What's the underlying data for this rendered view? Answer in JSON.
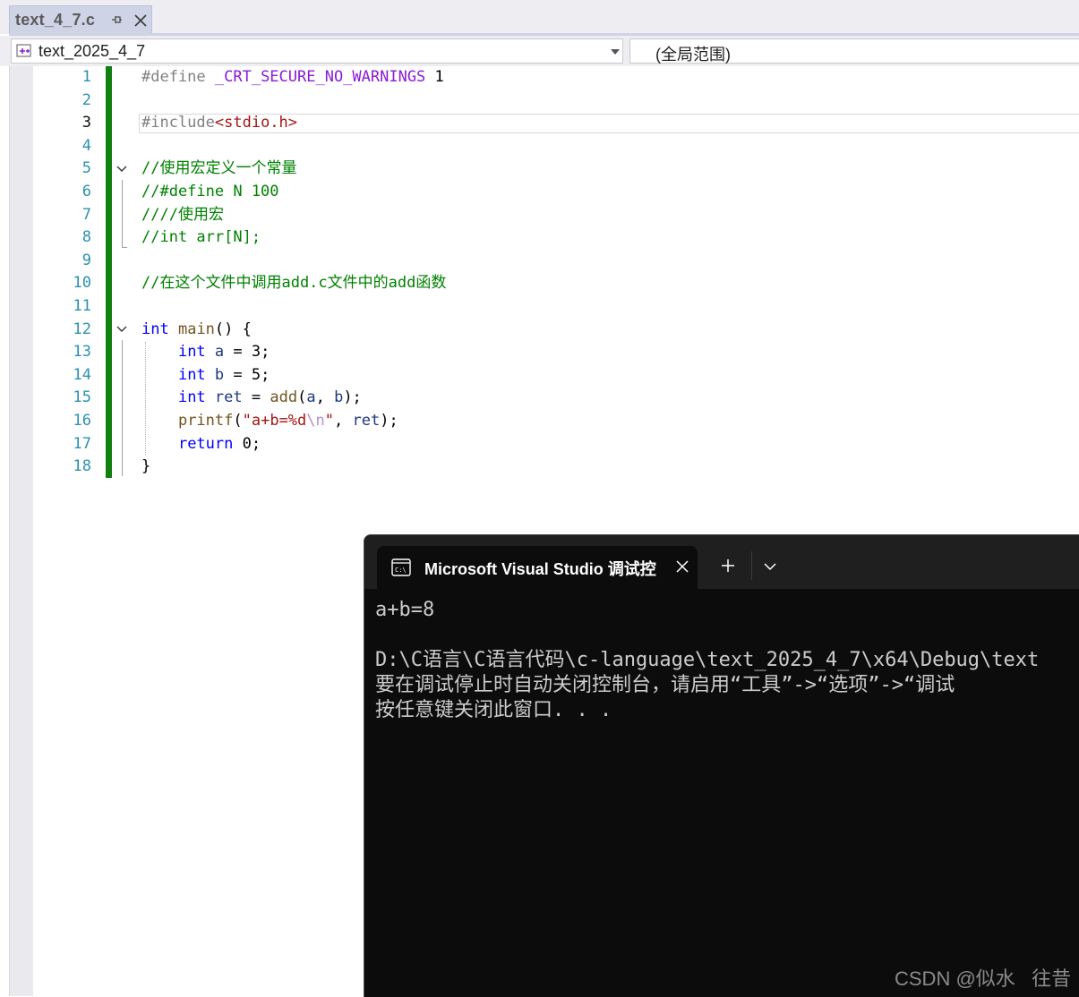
{
  "tab": {
    "title": "text_4_7.c"
  },
  "nav": {
    "project": "text_2025_4_7",
    "scope": "(全局范围)"
  },
  "editor": {
    "line_numbers": [
      "1",
      "2",
      "3",
      "4",
      "5",
      "6",
      "7",
      "8",
      "9",
      "10",
      "11",
      "12",
      "13",
      "14",
      "15",
      "16",
      "17",
      "18"
    ],
    "current_line": 3,
    "lines": [
      [
        "#define ",
        "_CRT_SECURE_NO_WARNINGS",
        " 1"
      ],
      [],
      [
        "#include",
        "<stdio.h>"
      ],
      [],
      [
        "//使用宏定义一个常量"
      ],
      [
        "//#define N 100"
      ],
      [
        "////使用宏"
      ],
      [
        "//int arr[N];"
      ],
      [],
      [
        "//在这个文件中调用add.c文件中的add函数"
      ],
      [],
      [
        "int",
        " ",
        "main",
        "() {"
      ],
      [
        "    ",
        "int",
        " ",
        "a",
        " = 3;"
      ],
      [
        "    ",
        "int",
        " ",
        "b",
        " = 5;"
      ],
      [
        "    ",
        "int",
        " ",
        "ret",
        " = ",
        "add",
        "(",
        "a",
        ", ",
        "b",
        ");"
      ],
      [
        "    ",
        "printf",
        "(",
        "\"a+b=%d",
        "\\n",
        "\"",
        ", ",
        "ret",
        ");"
      ],
      [
        "    ",
        "return",
        " 0;"
      ],
      [
        "}"
      ]
    ]
  },
  "console": {
    "title": "Microsoft Visual Studio 调试控",
    "output": [
      "a+b=8",
      "",
      "D:\\C语言\\C语言代码\\c-language\\text_2025_4_7\\x64\\Debug\\text",
      "要在调试停止时自动关闭控制台，请启用“工具”->“选项”->“调试",
      "按任意键关闭此窗口. . ."
    ]
  },
  "watermark": "CSDN @似水   往昔",
  "colors": {
    "keyword": "#0000ff",
    "comment": "#008000",
    "string": "#a31515",
    "macro": "#8a1bd8",
    "change_bar": "#108010",
    "console_bg": "#0c0c0c"
  }
}
